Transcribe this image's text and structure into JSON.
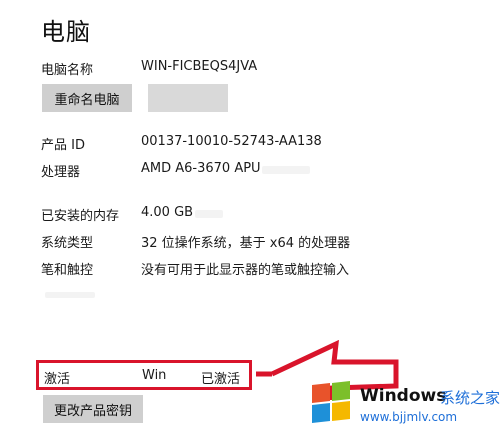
{
  "page": {
    "title": "电脑"
  },
  "computer": {
    "name_label": "电脑名称",
    "name_value": "WIN-FICBEQS4JVA",
    "rename_button": "重命名电脑"
  },
  "specs": [
    {
      "label": "产品 ID",
      "value": "00137-10010-52743-AA138"
    },
    {
      "label": "处理器",
      "value": "AMD A6-3670 APU"
    },
    {
      "label": "已安装的内存",
      "value": "4.00 GB"
    },
    {
      "label": "系统类型",
      "value": "32 位操作系统，基于 x64 的处理器"
    },
    {
      "label": "笔和触控",
      "value": "没有可用于此显示器的笔或触控输入"
    }
  ],
  "activation": {
    "label": "激活",
    "edition": "Win",
    "status": "已激活",
    "change_key_button": "更改产品密钥",
    "highlight_color": "#d9142b"
  },
  "watermark": {
    "brand": "Windows",
    "cn_text": "系统之家",
    "url": "www.bjjmlv.com",
    "colors": [
      "#e8532b",
      "#7cbf2a",
      "#1e90d8",
      "#f5b800"
    ]
  }
}
